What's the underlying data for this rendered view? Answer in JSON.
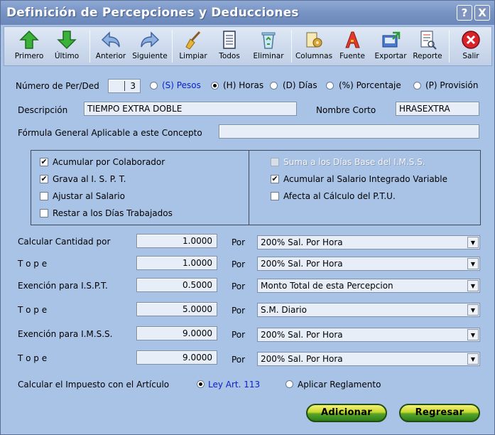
{
  "window": {
    "title": "Definición de Percepciones y Deducciones",
    "help": "?",
    "close": "X"
  },
  "toolbar": {
    "primero": "Primero",
    "ultimo": "Último",
    "anterior": "Anterior",
    "siguiente": "Siguiente",
    "limpiar": "Limpiar",
    "todos": "Todos",
    "eliminar": "Eliminar",
    "columnas": "Columnas",
    "fuente": "Fuente",
    "exportar": "Exportar",
    "reporte": "Reporte",
    "salir": "Salir"
  },
  "header": {
    "numero_label": "Número de Per/Ded",
    "numero_value": "3",
    "opt_pesos": "(S) Pesos",
    "opt_horas": "(H) Horas",
    "opt_dias": "(D) Días",
    "opt_porcentaje": "(%) Porcentaje",
    "opt_provision": "(P) Provisión",
    "selected_unit": "(H) Horas",
    "descripcion_label": "Descripción",
    "descripcion_value": "TIEMPO EXTRA DOBLE",
    "nombre_corto_label": "Nombre Corto",
    "nombre_corto_value": "HRASEXTRA",
    "formula_label": "Fórmula General Aplicable a este Concepto",
    "formula_value": ""
  },
  "checks": {
    "acumular_colaborador": {
      "label": "Acumular por Colaborador",
      "checked": true
    },
    "grava_ispt": {
      "label": "Grava al  I. S. P. T.",
      "checked": true
    },
    "ajustar_salario": {
      "label": "Ajustar al Salario",
      "checked": false
    },
    "restar_dias": {
      "label": "Restar a los Días Trabajados",
      "checked": false
    },
    "suma_dias_imss": {
      "label": "Suma a los Días Base del I.M.S.S.",
      "checked": false,
      "disabled": true
    },
    "acumular_sal_int": {
      "label": "Acumular al Salario Integrado Variable",
      "checked": true
    },
    "afecta_ptu": {
      "label": "Afecta al Cálculo del P.T.U.",
      "checked": false
    }
  },
  "calc": {
    "por_label": "Por",
    "rows": [
      {
        "label": "Calcular Cantidad por",
        "value": "1.0000",
        "select": "200% Sal. Por Hora"
      },
      {
        "label": "T o p e",
        "value": "1.0000",
        "select": "200% Sal. Por Hora"
      },
      {
        "label": "Exención para I.S.P.T.",
        "value": "0.5000",
        "select": "Monto Total de esta Percepcion"
      },
      {
        "label": "T o p e",
        "value": "5.0000",
        "select": "S.M. Diario"
      },
      {
        "label": "Exención para I.M.S.S.",
        "value": "9.0000",
        "select": "200% Sal. Por Hora"
      },
      {
        "label": "T o p e",
        "value": "9.0000",
        "select": "200% Sal. Por Hora"
      }
    ]
  },
  "impuesto": {
    "label": "Calcular el Impuesto con el Artículo",
    "opt_ley": "Ley Art. 113",
    "opt_reglamento": "Aplicar Reglamento",
    "selected": "Ley Art. 113"
  },
  "actions": {
    "adicionar": "Adicionar",
    "regresar": "Regresar"
  },
  "colors": {
    "window_bg": "#a9c3e6",
    "title_bar": "#7793c4",
    "selected_text": "#0b22c9",
    "button_green": "#5aa62a"
  }
}
